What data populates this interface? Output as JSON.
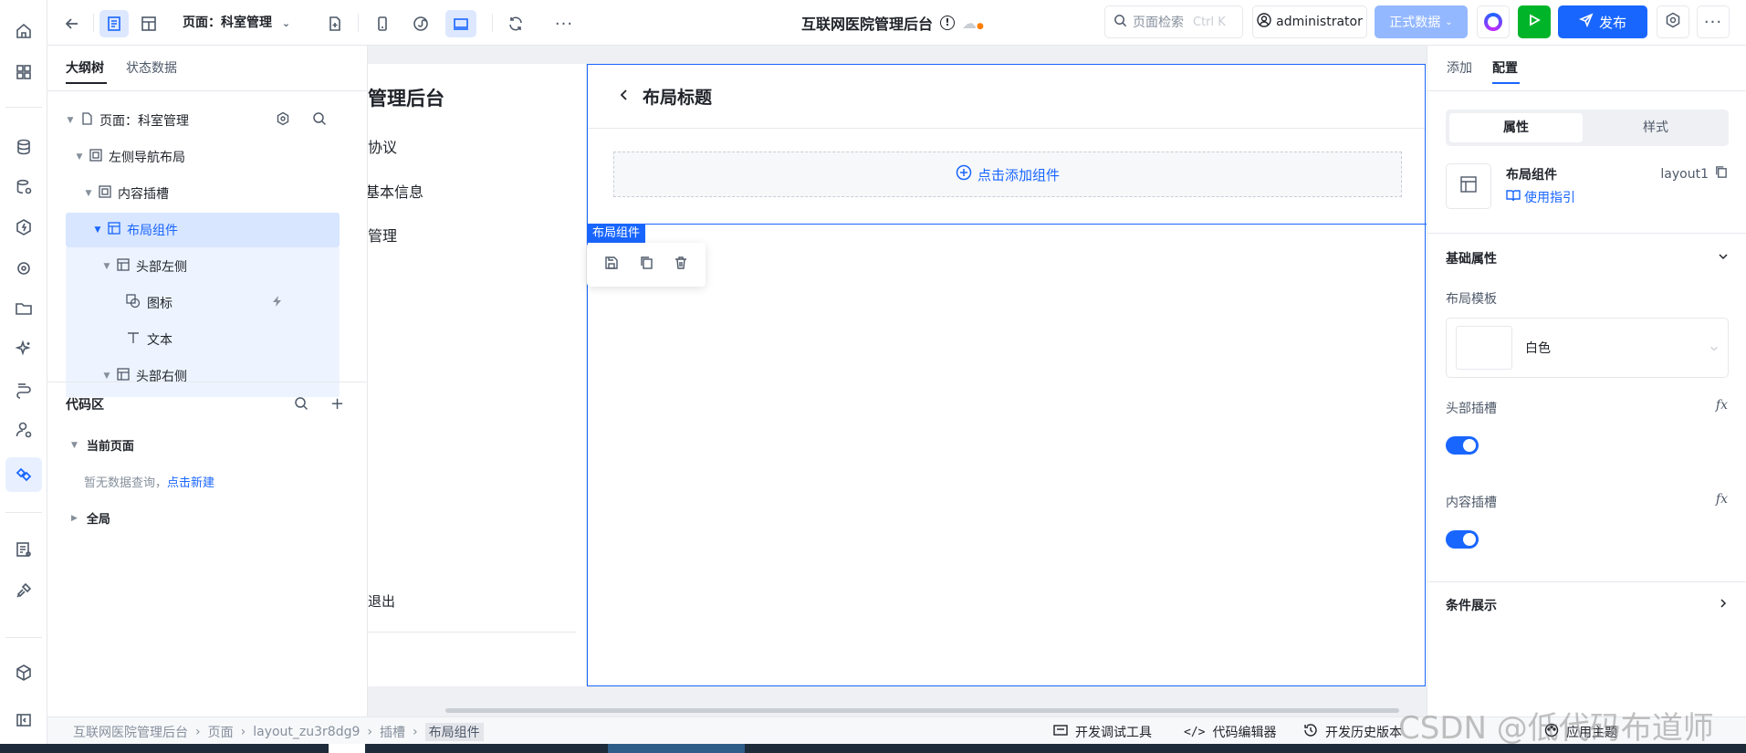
{
  "toolbar": {
    "page_label": "页面：科室管理",
    "app_title": "互联网医院管理后台",
    "search_placeholder": "页面检索",
    "search_shortcut": "Ctrl K",
    "user": "administrator",
    "data_env": "正式数据",
    "publish_label": "发布"
  },
  "outline": {
    "tabs": [
      "大纲树",
      "状态数据"
    ],
    "tree": [
      {
        "label": "页面：科室管理",
        "icon": "page-icon"
      },
      {
        "label": "左侧导航布局",
        "icon": "container-icon"
      },
      {
        "label": "内容插槽",
        "icon": "container-icon"
      },
      {
        "label": "布局组件",
        "icon": "layout-icon"
      },
      {
        "label": "头部左侧",
        "icon": "layout-icon"
      },
      {
        "label": "图标",
        "icon": "shapes-icon"
      },
      {
        "label": "文本",
        "icon": "text-icon"
      },
      {
        "label": "头部右侧",
        "icon": "layout-icon"
      }
    ],
    "code_area": {
      "title": "代码区",
      "current_page": "当前页面",
      "empty_text": "暂无数据查询，",
      "create_link": "点击新建",
      "global": "全局"
    }
  },
  "canvas": {
    "sidebar_title": "管理后台",
    "menu": [
      "协议",
      "基本信息",
      "管理"
    ],
    "logout": "退出",
    "layout_header_title": "布局标题",
    "add_component": "点击添加组件",
    "selection_label": "布局组件"
  },
  "config": {
    "tabs": [
      "添加",
      "配置"
    ],
    "segments": [
      "属性",
      "样式"
    ],
    "component_name": "布局组件",
    "component_id": "layout1",
    "guide_link": "使用指引",
    "basic_section": "基础属性",
    "layout_template_label": "布局模板",
    "layout_template_value": "白色",
    "header_slot_label": "头部插槽",
    "content_slot_label": "内容插槽",
    "condition_section": "条件展示"
  },
  "status": {
    "breadcrumb": [
      "互联网医院管理后台",
      "页面",
      "layout_zu3r8dg9",
      "插槽",
      "布局组件"
    ],
    "dev_tools": "开发调试工具",
    "code_editor": "代码编辑器",
    "history": "开发历史版本",
    "theme": "应用主题"
  },
  "watermark": "CSDN @低代码布道师",
  "colors": {
    "accent": "#1966ff",
    "run_green": "#00b42a",
    "muted_blue": "#94b8ff"
  }
}
